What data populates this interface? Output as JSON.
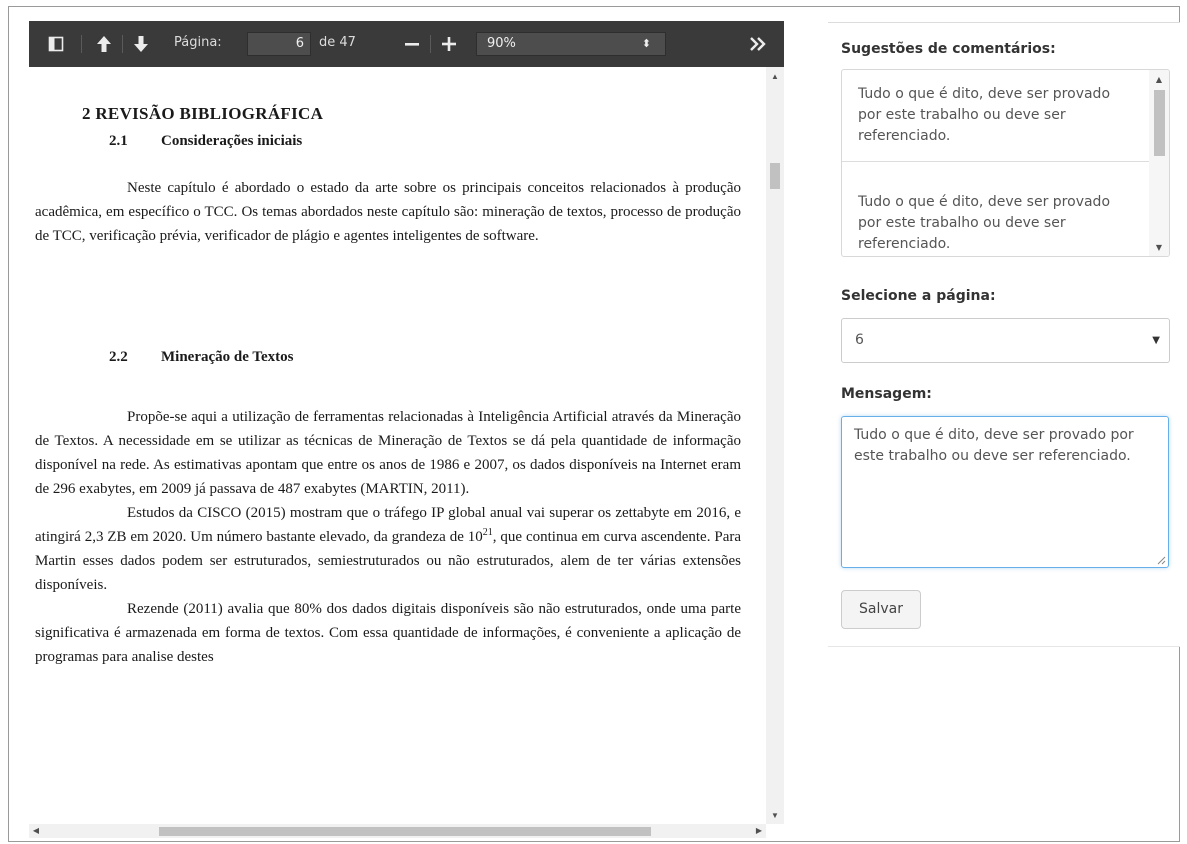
{
  "viewer": {
    "toolbar": {
      "page_label": "Página:",
      "page_value": "6",
      "page_total": "de 47",
      "zoom_value": "90%"
    },
    "document": {
      "heading_chapter": "2  REVISÃO BIBLIOGRÁFICA",
      "section_1_number": "2.1",
      "section_1_title": "Considerações iniciais",
      "section_1_para": "Neste capítulo é abordado o estado da arte sobre os principais conceitos relacionados à produção acadêmica, em específico o TCC. Os temas abordados neste capítulo são: mineração de textos, processo de produção de TCC, verificação prévia, verificador de plágio e agentes inteligentes de software.",
      "section_2_number": "2.2",
      "section_2_title": "Mineração de Textos",
      "para_1": "Propõe-se aqui a utilização de ferramentas relacionadas à Inteligência Artificial através da Mineração de Textos. A necessidade em se utilizar as técnicas de Mineração de Textos se dá pela quantidade de informação disponível na rede. As estimativas apontam que entre os anos de 1986 e 2007, os dados disponíveis na Internet eram de 296 exabytes, em 2009 já passava de 487 exabytes (MARTIN, 2011).",
      "para_2_a": "Estudos da CISCO (2015) mostram que o tráfego IP global anual vai superar os zettabyte em 2016, e atingirá 2,3 ZB em 2020. Um número bastante elevado, da grandeza de 10",
      "para_2_sup": "21",
      "para_2_b": ", que continua em curva ascendente. Para Martin esses dados podem ser estruturados, semiestruturados ou não estruturados, alem de ter várias extensões disponíveis.",
      "para_3": "Rezende (2011) avalia que 80% dos dados digitais disponíveis são não estruturados, onde uma parte significativa é armazenada em forma de textos. Com essa quantidade de informações, é conveniente a aplicação de programas para analise destes"
    }
  },
  "side": {
    "suggestions_label": "Sugestões de comentários:",
    "suggestions": [
      "Tudo o que é dito, deve ser provado por este trabalho ou deve ser referenciado.",
      "Tudo o que é dito, deve ser provado por este trabalho ou deve ser referenciado."
    ],
    "page_select_label": "Selecione a página:",
    "page_select_value": "6",
    "message_label": "Mensagem:",
    "message_value": "Tudo o que é dito, deve ser provado por este trabalho ou deve ser referenciado.",
    "save_label": "Salvar"
  }
}
